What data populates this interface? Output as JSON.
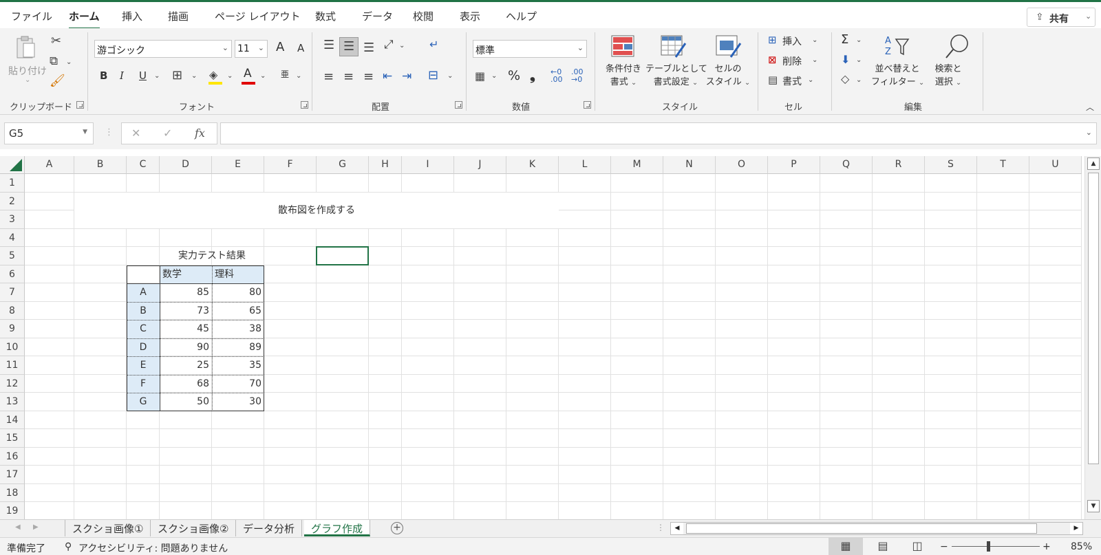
{
  "ribbon_tabs": [
    "ファイル",
    "ホーム",
    "挿入",
    "描画",
    "ページ レイアウト",
    "数式",
    "データ",
    "校閲",
    "表示",
    "ヘルプ"
  ],
  "active_tab": "ホーム",
  "share": {
    "label": "共有",
    "icon": "share-icon"
  },
  "clipboard": {
    "paste_label": "貼り付け",
    "group_label": "クリップボード"
  },
  "font": {
    "name": "游ゴシック",
    "size": "11",
    "group_label": "フォント",
    "bold": "B",
    "italic": "I",
    "underline": "U",
    "font_color": "A",
    "grow": "A",
    "shrink": "A",
    "phonetic": "亜"
  },
  "alignment": {
    "group_label": "配置"
  },
  "number": {
    "format": "標準",
    "group_label": "数値",
    "percent": "%",
    "comma": "❟"
  },
  "styles": {
    "group_label": "スタイル",
    "conditional": [
      "条件付き",
      "書式"
    ],
    "table": [
      "テーブルとして",
      "書式設定"
    ],
    "cell": [
      "セルの",
      "スタイル"
    ]
  },
  "cells": {
    "group_label": "セル",
    "insert": "挿入",
    "delete": "削除",
    "format": "書式"
  },
  "editing": {
    "group_label": "編集",
    "sort": [
      "並べ替えと",
      "フィルター"
    ],
    "find": [
      "検索と",
      "選択"
    ],
    "sigma": "Σ"
  },
  "formula_bar": {
    "name_box": "G5",
    "formula": "",
    "cancel": "✕",
    "enter": "✓",
    "fx": "fx"
  },
  "columns": [
    "A",
    "B",
    "C",
    "D",
    "E",
    "F",
    "G",
    "H",
    "I",
    "J",
    "K",
    "L",
    "M",
    "N",
    "O",
    "P",
    "Q",
    "R",
    "S",
    "T",
    "U"
  ],
  "rows": [
    "1",
    "2",
    "3",
    "4",
    "5",
    "6",
    "7",
    "8",
    "9",
    "10",
    "11",
    "12",
    "13",
    "14",
    "15",
    "16",
    "17",
    "18",
    "19"
  ],
  "sheet": {
    "merged_title": "散布図を作成する",
    "table_title": "実力テスト結果",
    "headers": [
      "数学",
      "理科"
    ],
    "records": [
      {
        "label": "A",
        "math": "85",
        "science": "80"
      },
      {
        "label": "B",
        "math": "73",
        "science": "65"
      },
      {
        "label": "C",
        "math": "45",
        "science": "38"
      },
      {
        "label": "D",
        "math": "90",
        "science": "89"
      },
      {
        "label": "E",
        "math": "25",
        "science": "35"
      },
      {
        "label": "F",
        "math": "68",
        "science": "70"
      },
      {
        "label": "G",
        "math": "50",
        "science": "30"
      }
    ],
    "header_fill": "#ddebf7"
  },
  "sheet_tabs": [
    "スクショ画像①",
    "スクショ画像②",
    "データ分析",
    "グラフ作成"
  ],
  "active_sheet": "グラフ作成",
  "status": {
    "ready": "準備完了",
    "accessibility": "アクセシビリティ: 問題ありません",
    "zoom": "85%",
    "zoom_minus": "−",
    "zoom_plus": "+"
  },
  "colors": {
    "accent": "#217346"
  }
}
